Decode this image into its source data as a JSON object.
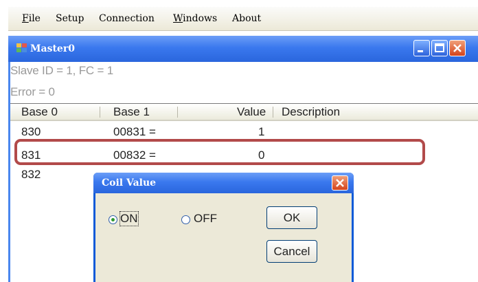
{
  "menu": {
    "file": {
      "u": "F",
      "rest": "ile"
    },
    "setup": "Setup",
    "connection": "Connection",
    "windows": {
      "u": "W",
      "rest": "indows"
    },
    "about": "About"
  },
  "window": {
    "title": "Master0",
    "status_line1": "Slave ID = 1, FC = 1",
    "status_line2": "Error = 0"
  },
  "list": {
    "columns": [
      "Base 0",
      "Base 1",
      "Value",
      "Description"
    ],
    "rows": [
      {
        "base0": "830",
        "base1": "00831  =",
        "value": "1"
      },
      {
        "base0": "831",
        "base1": "00832  =",
        "value": "0"
      },
      {
        "base0": "832",
        "base1": "",
        "value": ""
      }
    ]
  },
  "dialog": {
    "title": "Coil Value",
    "on_label": "ON",
    "off_label": "OFF",
    "ok_label": "OK",
    "cancel_label": "Cancel",
    "selected": "ON"
  },
  "colors": {
    "titlebar": "#2a66dd",
    "highlight_border": "#b24a4a"
  }
}
